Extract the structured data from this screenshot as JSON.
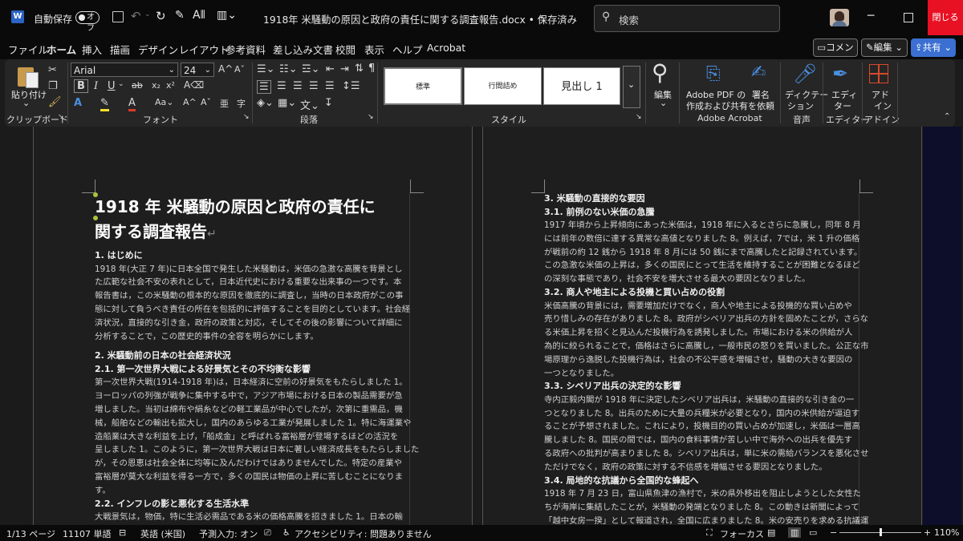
{
  "titlebar": {
    "autosave_label": "自動保存",
    "autosave_state": "オフ",
    "document_title": "1918年 米騒動の原因と政府の責任に関する調査報告.docx • 保存済み",
    "search_placeholder": "検索",
    "close_label": "閉じる"
  },
  "menu": {
    "items": [
      "ファイル",
      "ホーム",
      "挿入",
      "描画",
      "デザイン",
      "レイアウト",
      "参考資料",
      "差し込み文書",
      "校閲",
      "表示",
      "ヘルプ",
      "Acrobat"
    ],
    "active": "ホーム",
    "comment_label": "コメント",
    "edit_label": "編集",
    "share_label": "共有"
  },
  "ribbon": {
    "paste_label": "貼り付け",
    "clipboard_label": "クリップボード",
    "font_name": "Arial",
    "font_size": "24",
    "font_label": "フォント",
    "paragraph_label": "段落",
    "styles": [
      "標準",
      "行間詰め",
      "見出し 1"
    ],
    "styles_label": "スタイル",
    "editing_label": "編集",
    "adobe_create_line1": "Adobe PDF の",
    "adobe_create_line2": "作成および共有",
    "adobe_sign_line1": "署名",
    "adobe_sign_line2": "を依頼",
    "adobe_acrobat_label": "Adobe Acrobat",
    "dictation_line1": "ディクテー",
    "dictation_line2": "ション",
    "voice_label": "音声",
    "editor_line1": "エディ",
    "editor_line2": "ター",
    "editor_label": "エディター",
    "addin_line1": "アド",
    "addin_line2": "イン",
    "addin_label": "アドイン"
  },
  "doc": {
    "title_line1": "1918 年  米騒動の原因と政府の責任に",
    "title_line2": "関する調査報告",
    "left": [
      {
        "t": "h",
        "text": "1. はじめに"
      },
      {
        "t": "p",
        "text": "1918 年(大正 7 年)に日本全国で発生した米騒動は，米価の急激な高騰を背景とし"
      },
      {
        "t": "p",
        "text": "た広範な社会不安の表れとして，日本近代史における重要な出来事の一つです。本"
      },
      {
        "t": "p",
        "text": "報告書は，この米騒動の根本的な原因を徹底的に調査し，当時の日本政府がこの事"
      },
      {
        "t": "p",
        "text": "態に対して負うべき責任の所在を包括的に評価することを目的としています。社会経"
      },
      {
        "t": "p",
        "text": "済状況，直接的な引き金，政府の政策と対応，そしてその後の影響について詳細に"
      },
      {
        "t": "p",
        "text": "分析することで，この歴史的事件の全容を明らかにします。"
      },
      {
        "t": "gap",
        "text": ""
      },
      {
        "t": "h",
        "text": "2. 米騒動前の日本の社会経済状況"
      },
      {
        "t": "h",
        "text": "2.1. 第一次世界大戦による好景気とその不均衡な影響"
      },
      {
        "t": "p",
        "text": "第一次世界大戦(1914-1918 年)は，日本経済に空前の好景気をもたらしました 1。"
      },
      {
        "t": "p",
        "text": "ヨーロッパの列強が戦争に集中する中で，アジア市場における日本の製品需要が急"
      },
      {
        "t": "p",
        "text": "増しました。当初は綿布や絹糸などの軽工業品が中心でしたが，次第に重需品，機"
      },
      {
        "t": "p",
        "text": "械，船舶などの輸出も拡大し，国内のあらゆる工業が発展しました 1。特に海運業や"
      },
      {
        "t": "p",
        "text": "造船業は大きな利益を上げ，「船成金」と呼ばれる富裕層が登場するほどの活況を"
      },
      {
        "t": "p",
        "text": "呈しました 1。このように，第一次世界大戦は日本に著しい経済成長をもたらしました"
      },
      {
        "t": "p",
        "text": "が，その恩恵は社会全体に均等に及んだわけではありませんでした。特定の産業や"
      },
      {
        "t": "p",
        "text": "富裕層が莫大な利益を得る一方で，多くの国民は物価の上昇に苦しむことになりま"
      },
      {
        "t": "p",
        "text": "す。"
      },
      {
        "t": "h",
        "text": "2.2. インフレの影と悪化する生活水準"
      },
      {
        "t": "p",
        "text": "大戦景気は，物価，特に生活必需品である米の価格高騰を招きました 1。日本の輸"
      }
    ],
    "right": [
      {
        "t": "h",
        "text": "3. 米騒動の直接的な要因"
      },
      {
        "t": "h",
        "text": "3.1. 前例のない米価の急騰"
      },
      {
        "t": "p",
        "text": "1917 年頃から上昇傾向にあった米価は，1918 年に入るとさらに急騰し，同年 8 月"
      },
      {
        "t": "p",
        "text": "には前年の数倍に達する異常な高値となりました 8。例えば，7では，米 1 升の価格"
      },
      {
        "t": "p",
        "text": "が戦前の約 12 銭から 1918 年 8 月には 50 銭にまで高騰したと記録されています。"
      },
      {
        "t": "p",
        "text": "この急激な米価の上昇は，多くの国民にとって生活を維持することが困難となるほど"
      },
      {
        "t": "p",
        "text": "の深刻な事態であり，社会不安を増大させる最大の要因となりました。"
      },
      {
        "t": "h",
        "text": "3.2. 商人や地主による投機と買い占めの役割"
      },
      {
        "t": "p",
        "text": "米価高騰の背景には，需要増加だけでなく，商人や地主による投機的な買い占めや"
      },
      {
        "t": "p",
        "text": "売り惜しみの存在がありました 8。政府がシベリア出兵の方針を固めたことが，さらな"
      },
      {
        "t": "p",
        "text": "る米価上昇を招くと見込んだ投機行為を誘発しました。市場における米の供給が人"
      },
      {
        "t": "p",
        "text": "為的に絞られることで，価格はさらに高騰し，一般市民の怒りを買いました。公正な市"
      },
      {
        "t": "p",
        "text": "場原理から逸脱した投機行為は，社会の不公平感を増幅させ，騒動の大きな要因の"
      },
      {
        "t": "p",
        "text": "一つとなりました。"
      },
      {
        "t": "h",
        "text": "3.3. シベリア出兵の決定的な影響"
      },
      {
        "t": "p",
        "text": "寺内正毅内閣が 1918 年に決定したシベリア出兵は，米騒動の直接的な引き金の一"
      },
      {
        "t": "p",
        "text": "つとなりました 8。出兵のために大量の兵糧米が必要となり，国内の米供給が逼迫す"
      },
      {
        "t": "p",
        "text": "ることが予想されました。これにより，投機目的の買い占めが加速し，米価は一層高"
      },
      {
        "t": "p",
        "text": "騰しました 8。国民の間では，国内の食料事情が苦しい中で海外への出兵を優先す"
      },
      {
        "t": "p",
        "text": "る政府への批判が高まりました 8。シベリア出兵は，単に米の需給バランスを悪化させ"
      },
      {
        "t": "p",
        "text": "ただけでなく，政府の政策に対する不信感を増幅させる要因となりました。"
      },
      {
        "t": "h",
        "text": "3.4. 局地的な抗議から全国的な蜂起へ"
      },
      {
        "t": "p",
        "text": "1918 年 7 月 23 日，富山県魚津の漁村で，米の県外移出を阻止しようとした女性た"
      },
      {
        "t": "p",
        "text": "ちが海岸に集結したことが，米騒動の発端となりました 8。この動きは新聞によって"
      },
      {
        "t": "p",
        "text": "「越中女房一揆」として報道され，全国に広まりました 8。米の安売りを求める抗議運"
      }
    ]
  },
  "status": {
    "page": "1/13 ページ",
    "words": "11107 単語",
    "language": "英語 (米国)",
    "predictive": "予測入力: オン",
    "accessibility": "アクセシビリティ: 問題ありません",
    "focus": "フォーカス",
    "zoom": "110%"
  }
}
